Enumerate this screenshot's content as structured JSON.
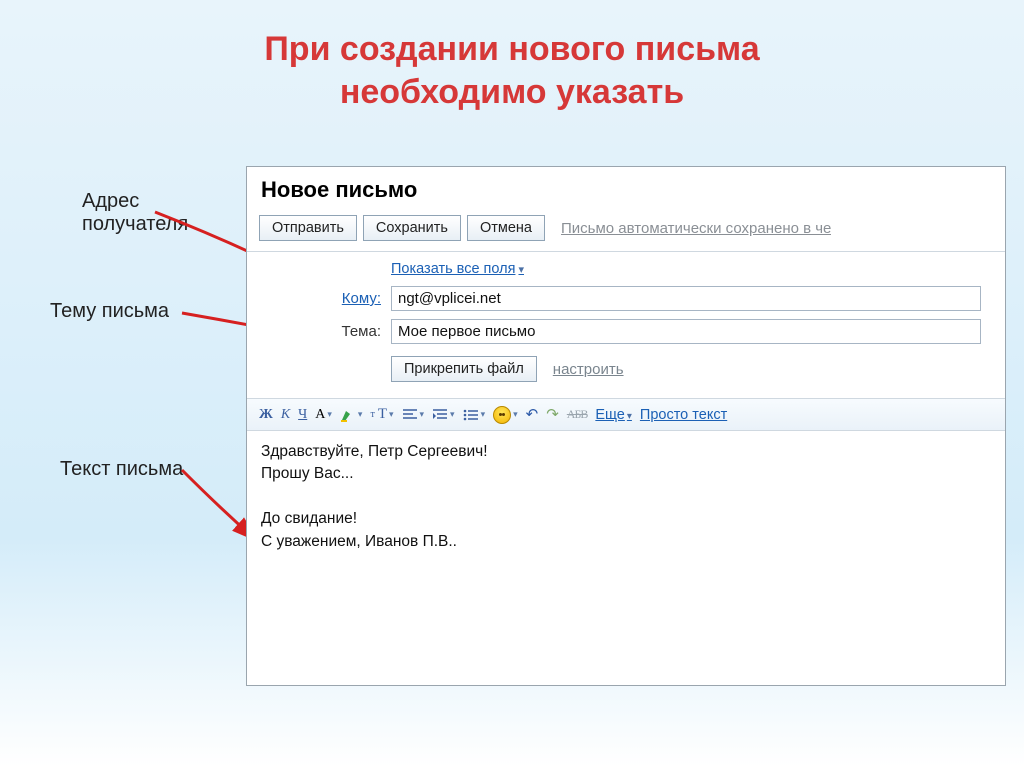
{
  "slide": {
    "title_line1": "При создании нового письма",
    "title_line2": "необходимо указать"
  },
  "annotations": {
    "recipient_label_line1": "Адрес",
    "recipient_label_line2": "получателя",
    "subject_label": "Тему письма",
    "body_label": "Текст письма"
  },
  "compose": {
    "title": "Новое письмо",
    "buttons": {
      "send": "Отправить",
      "save": "Сохранить",
      "cancel": "Отмена"
    },
    "status_text": "Письмо автоматически сохранено в че",
    "show_all_fields": "Показать все поля",
    "fields": {
      "to_label": "Кому:",
      "to_value": "ngt@vplicei.net",
      "subject_label": "Тема:",
      "subject_value": "Мое первое письмо"
    },
    "attach_button": "Прикрепить файл",
    "configure_link": "настроить",
    "format": {
      "bold": "Ж",
      "italic": "К",
      "underline": "Ч",
      "colorA": "А",
      "sizeSmall": "т",
      "sizeBig": "Т",
      "strike": "АБВ",
      "more": "Еще",
      "plain": "Просто текст"
    },
    "body": "Здравствуйте, Петр Сергеевич!\nПрошу Вас...\n\nДо свидание!\nС уважением, Иванов П.В.."
  }
}
